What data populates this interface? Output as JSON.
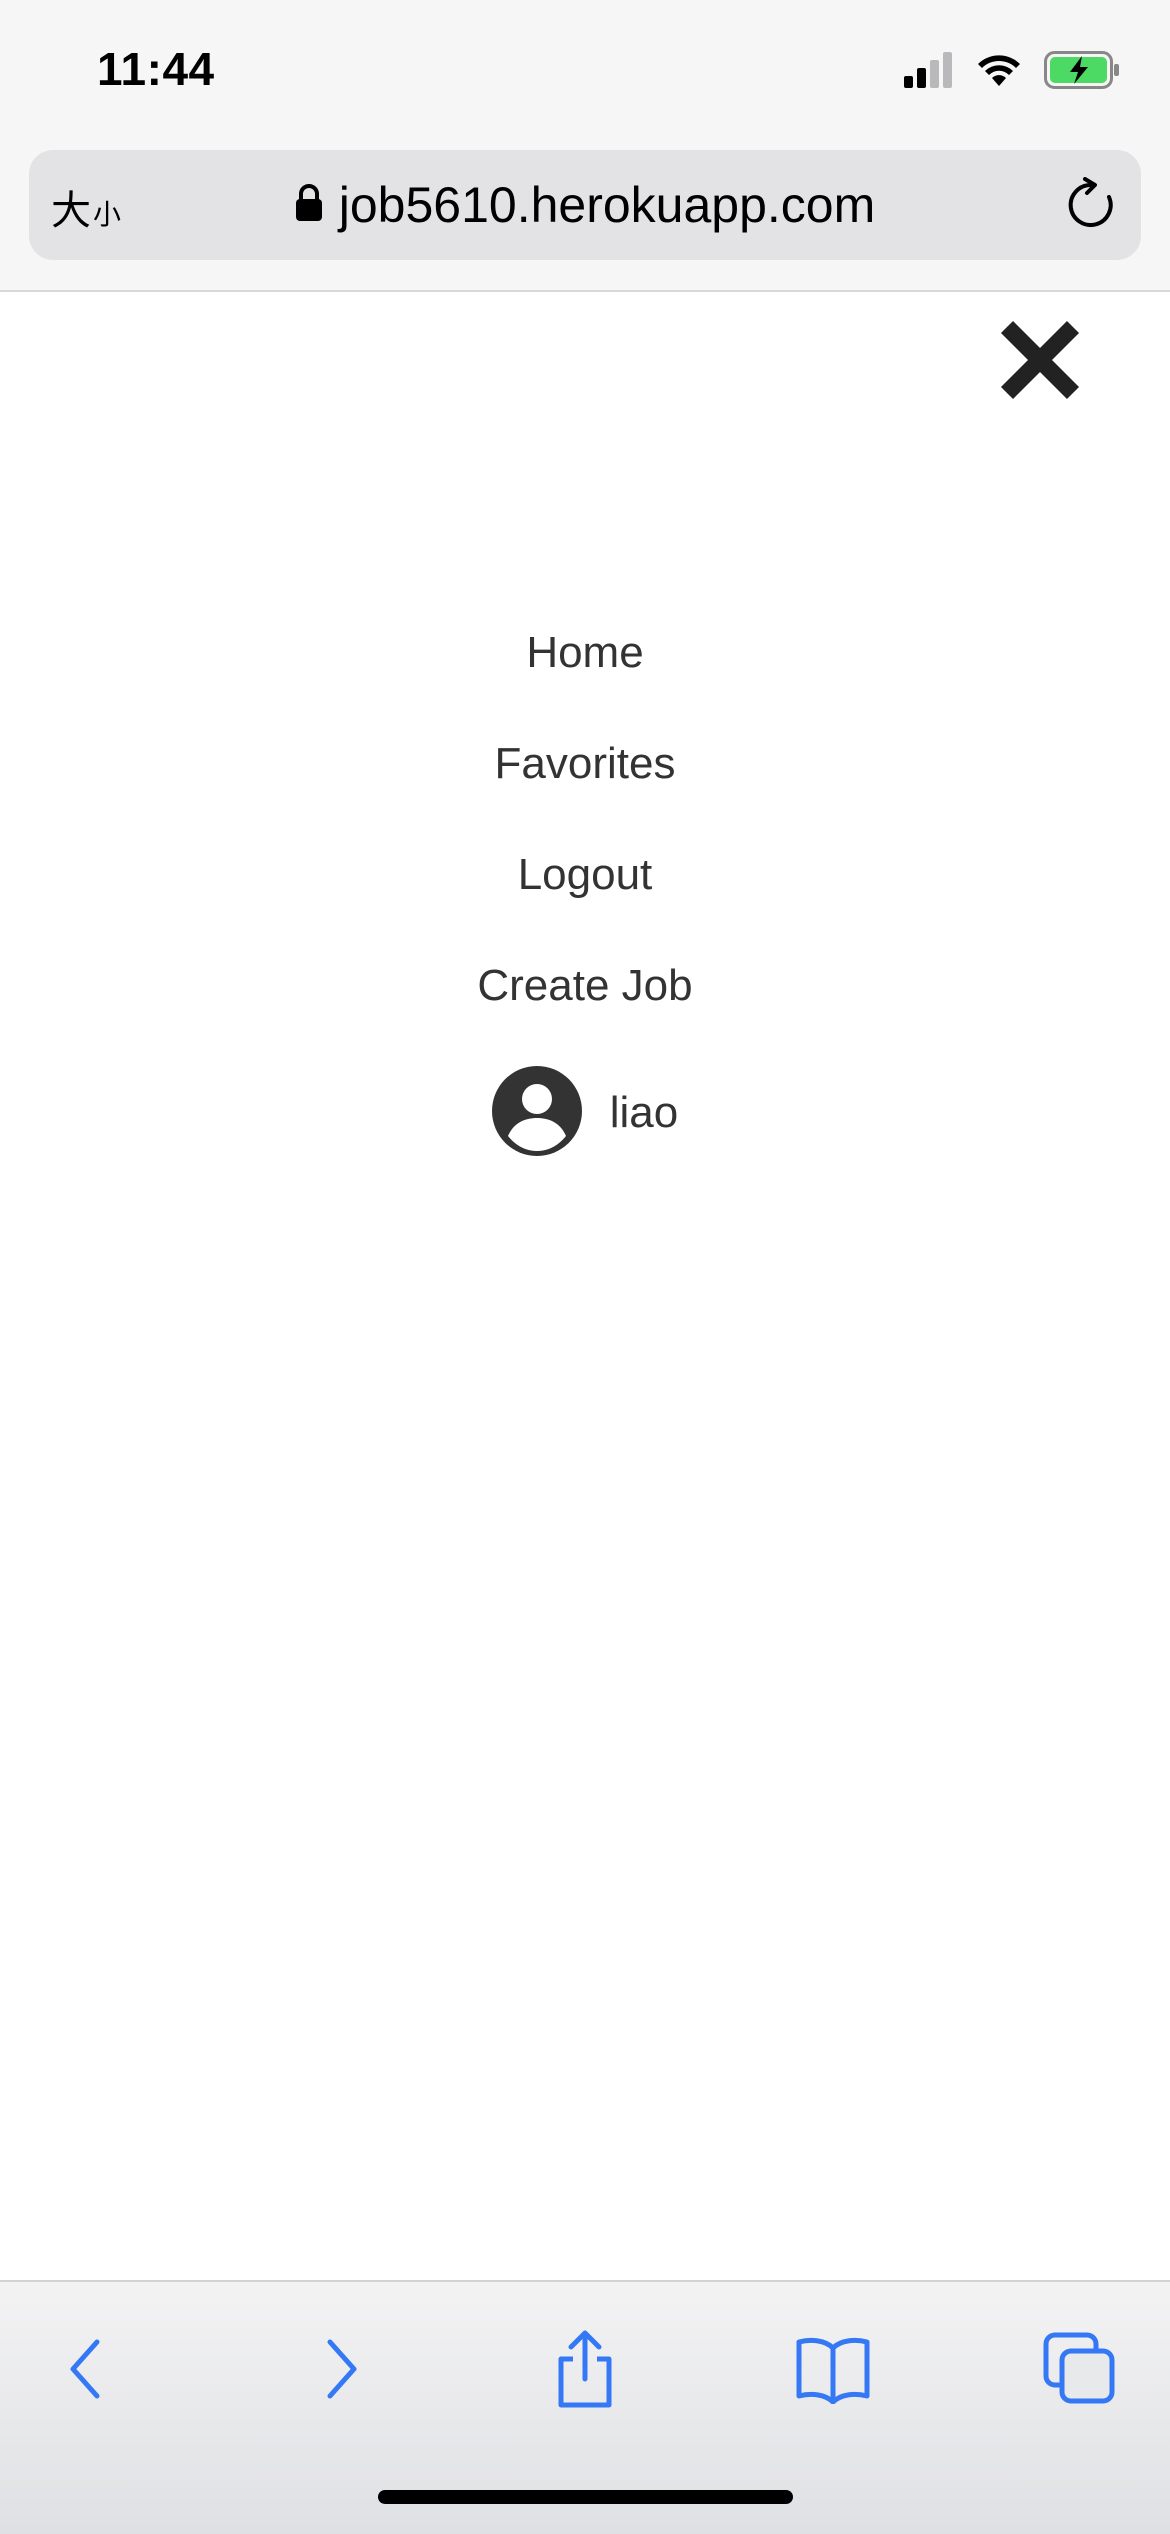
{
  "status_bar": {
    "time": "11:44",
    "icons": [
      "cellular-signal-icon",
      "wifi-icon",
      "battery-charging-icon"
    ],
    "battery_color": "#4cd964"
  },
  "browser": {
    "text_size_big": "大",
    "text_size_small": "小",
    "url": "job5610.herokuapp.com",
    "icons": [
      "lock-icon",
      "reload-icon"
    ]
  },
  "menu": {
    "close_icon": "close-icon",
    "items": [
      {
        "label": "Home"
      },
      {
        "label": "Favorites"
      },
      {
        "label": "Logout"
      },
      {
        "label": "Create Job"
      }
    ],
    "user": {
      "name": "liao",
      "icon": "user-avatar-icon"
    }
  },
  "toolbar": {
    "icons": [
      "back-icon",
      "forward-icon",
      "share-icon",
      "bookmarks-icon",
      "tabs-icon"
    ],
    "accent_color": "#3478f6"
  },
  "colors": {
    "text": "#333333",
    "chrome_bg": "#f6f6f6",
    "address_pill": "#e3e3e5"
  }
}
